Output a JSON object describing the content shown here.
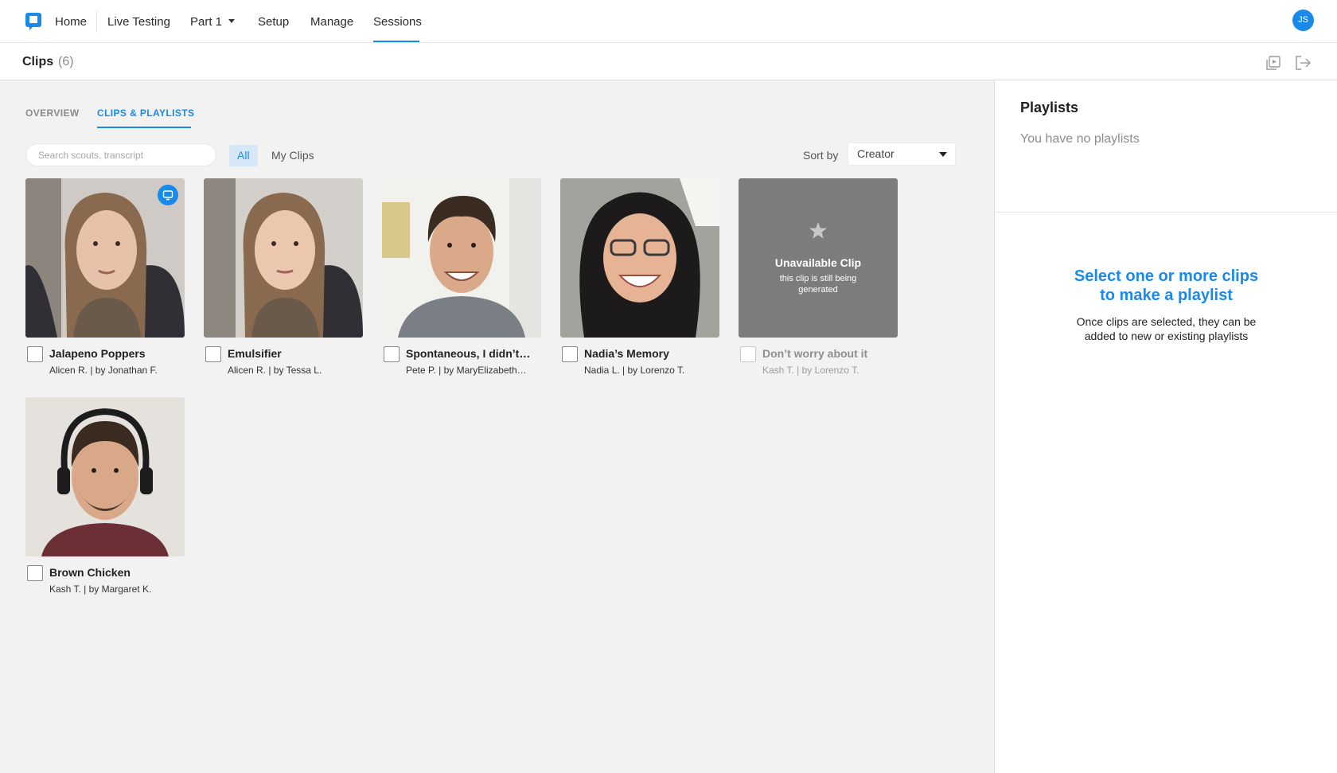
{
  "nav": {
    "items": [
      {
        "label": "Home"
      },
      {
        "label": "Live Testing"
      },
      {
        "label": "Part 1"
      },
      {
        "label": "Setup"
      },
      {
        "label": "Manage"
      },
      {
        "label": "Sessions"
      }
    ],
    "active": "Sessions",
    "avatar_initials": "JS",
    "logo_icon": "chat-bubble-logo-icon"
  },
  "subheader": {
    "title": "Clips",
    "count": "(6)",
    "icons": [
      "playlist-icon",
      "share-exit-icon"
    ]
  },
  "tabs": [
    {
      "label": "OVERVIEW",
      "active": false
    },
    {
      "label": "CLIPS & PLAYLISTS",
      "active": true
    }
  ],
  "search": {
    "placeholder": "Search scouts, transcript",
    "value": ""
  },
  "filters": [
    {
      "label": "All",
      "active": true
    },
    {
      "label": "My Clips",
      "active": false
    }
  ],
  "sort": {
    "label": "Sort by",
    "value": "Creator"
  },
  "clips": [
    {
      "title": "Jalapeno Poppers",
      "meta": "Alicen R. | by Jonathan F.",
      "available": true,
      "badge_icon": "screen-share-icon"
    },
    {
      "title": "Emulsifier",
      "meta": "Alicen R. | by Tessa L.",
      "available": true
    },
    {
      "title": "Spontaneous, I didn’t…",
      "meta": "Pete P. | by MaryElizabeth…",
      "available": true
    },
    {
      "title": "Nadia’s Memory",
      "meta": "Nadia L. | by Lorenzo T.",
      "available": true
    },
    {
      "title": "Don’t worry about it",
      "meta": "Kash T. | by Lorenzo T.",
      "available": false,
      "unavailable_title": "Unavailable Clip",
      "unavailable_text": "this clip is still being generated"
    },
    {
      "title": "Brown Chicken",
      "meta": "Kash T. | by Margaret K.",
      "available": true
    }
  ],
  "playlists": {
    "title": "Playlists",
    "empty_text": "You have no playlists",
    "cta_line1": "Select one or more clips",
    "cta_line2": "to make a playlist",
    "help_line1": "Once clips are selected, they can be",
    "help_line2": "added to new or existing playlists"
  },
  "colors": {
    "accent": "#1a8aea",
    "panel_bg": "#f2f2f2",
    "unavailable_bg": "#7c7c7c"
  }
}
